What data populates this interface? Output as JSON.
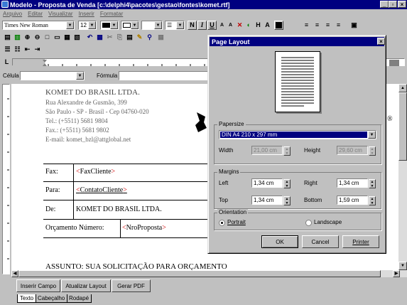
{
  "window": {
    "title": "Modelo - Proposta de Venda [c:\\delphi4\\pacotes\\gestao\\fontes\\komet.rtf]"
  },
  "menu": [
    "Arquivo",
    "Editar",
    "Visualizar",
    "Inserir",
    "Formatar"
  ],
  "toolbar": {
    "font_name": "Times New Roman",
    "font_size": "12",
    "bold": "N",
    "italic": "I",
    "underline": "U",
    "superscript": "A",
    "subscript": "A",
    "h_label": "H",
    "a_label": "A"
  },
  "cell_bar": {
    "cell_label": "Célula",
    "formula_label": "Fórmula"
  },
  "document": {
    "company": "KOMET DO BRASIL LTDA.",
    "address_lines": [
      "Rua Alexandre de Gusmão, 399",
      "São Paulo - SP - Brasil - Cep 04760-020",
      "Tel.: (+5511) 5681 9804",
      "Fax.: (+5511) 5681 9802",
      "E-mail: komet_bzl@attglobal.net"
    ],
    "registered_mark": "®",
    "table": [
      {
        "label": "Fax:",
        "value": "FaxCliente"
      },
      {
        "label": "Para:",
        "value": "ContatoCliente"
      },
      {
        "label": "De:",
        "value": "KOMET DO BRASIL LTDA."
      },
      {
        "label": "Orçamento Número:",
        "value": "NroProposta"
      }
    ],
    "subject": "ASSUNTO:  SUA SOLICITAÇÃO PARA ORÇAMENTO"
  },
  "bottom_buttons": [
    "Inserir Campo",
    "Atualizar Layout",
    "Gerar PDF"
  ],
  "tabs": [
    "Texto",
    "Cabeçalho",
    "Rodapé"
  ],
  "dialog": {
    "title": "Page Layout",
    "papersize_group": "Papersize",
    "papersize_value": "DIN A4 210 x 297 mm",
    "width_label": "Width",
    "width_value": "21,00 cm",
    "height_label": "Height",
    "height_value": "29,60 cm",
    "margins_group": "Margins",
    "left_label": "Left",
    "left_value": "1,34 cm",
    "right_label": "Right",
    "right_value": "1,34 cm",
    "top_label": "Top",
    "top_value": "1,34 cm",
    "bottom_label": "Bottom",
    "bottom_value": "1,59 cm",
    "orientation_group": "Orientation",
    "portrait_label": "Portrait",
    "landscape_label": "Landscape",
    "orientation_selected": "Portrait",
    "ok_label": "OK",
    "cancel_label": "Cancel",
    "printer_label": "Printer"
  }
}
